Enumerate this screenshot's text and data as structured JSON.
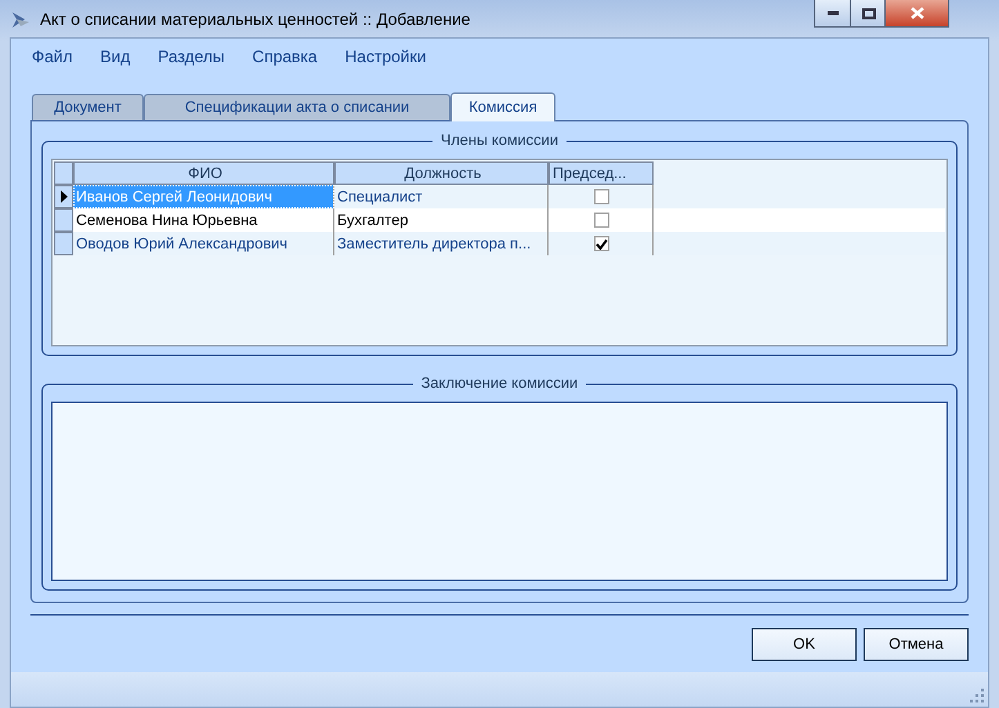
{
  "window": {
    "title": "Акт о списании материальных ценностей :: Добавление"
  },
  "menu": [
    "Файл",
    "Вид",
    "Разделы",
    "Справка",
    "Настройки"
  ],
  "tabs": [
    {
      "label": "Документ",
      "selected": false
    },
    {
      "label": "Спецификации акта о списании",
      "selected": false
    },
    {
      "label": "Комиссия",
      "selected": true
    }
  ],
  "members": {
    "title": "Члены комиссии",
    "columns": [
      "ФИО",
      "Должность",
      "Председ..."
    ],
    "rows": [
      {
        "name": "Иванов Сергей Леонидович",
        "position": "Специалист",
        "chairman": false,
        "selected": true
      },
      {
        "name": "Семенова Нина Юрьевна",
        "position": "Бухгалтер",
        "chairman": false,
        "selected": false
      },
      {
        "name": "Оводов Юрий Александрович",
        "position": "Заместитель директора п...",
        "chairman": true,
        "selected": false
      }
    ]
  },
  "conclusion": {
    "title": "Заключение комиссии"
  },
  "buttons": [
    "OK",
    "Отмена"
  ]
}
